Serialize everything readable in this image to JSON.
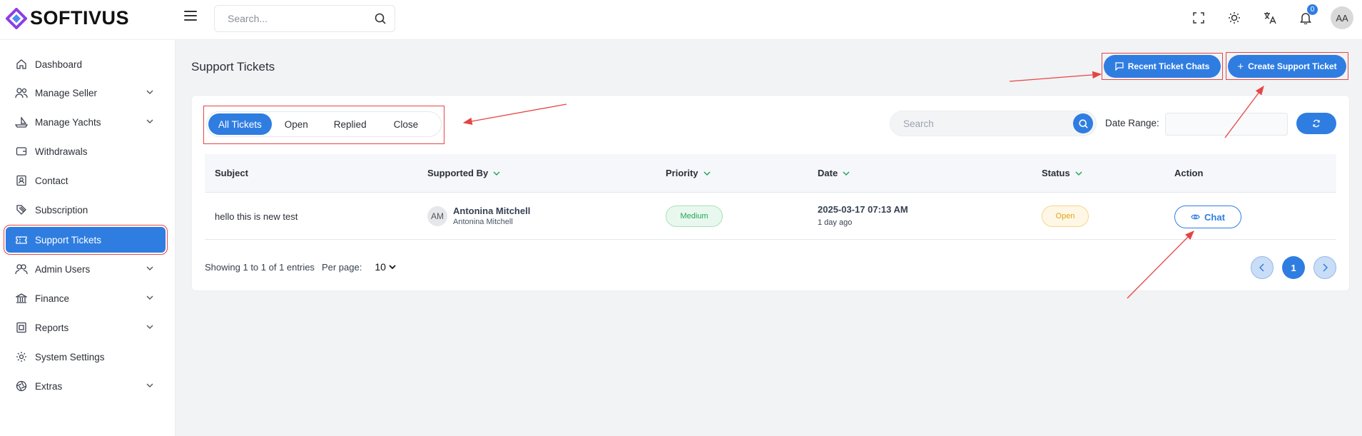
{
  "app": {
    "name": "SOFTIVUS",
    "brand_color": "#2f7de1",
    "accent_color": "#8b3fe6"
  },
  "topbar": {
    "search_placeholder": "Search...",
    "notification_count": "0",
    "user_initials": "AA",
    "icons": [
      "fullscreen-icon",
      "sun-icon",
      "translate-icon",
      "bell-icon"
    ]
  },
  "sidebar": {
    "items": [
      {
        "label": "Dashboard",
        "icon": "home-icon",
        "expandable": false
      },
      {
        "label": "Manage Seller",
        "icon": "users-icon",
        "expandable": true
      },
      {
        "label": "Manage Yachts",
        "icon": "boat-icon",
        "expandable": true
      },
      {
        "label": "Withdrawals",
        "icon": "wallet-icon",
        "expandable": false
      },
      {
        "label": "Contact",
        "icon": "contact-icon",
        "expandable": false
      },
      {
        "label": "Subscription",
        "icon": "tag-icon",
        "expandable": false
      },
      {
        "label": "Support Tickets",
        "icon": "ticket-icon",
        "expandable": false,
        "active": true
      },
      {
        "label": "Admin Users",
        "icon": "admin-users-icon",
        "expandable": true
      },
      {
        "label": "Finance",
        "icon": "bank-icon",
        "expandable": true
      },
      {
        "label": "Reports",
        "icon": "report-icon",
        "expandable": true
      },
      {
        "label": "System Settings",
        "icon": "gear-icon",
        "expandable": false
      },
      {
        "label": "Extras",
        "icon": "aperture-icon",
        "expandable": true
      }
    ]
  },
  "page": {
    "title": "Support Tickets",
    "recent_chats_label": "Recent Ticket Chats",
    "create_ticket_label": "Create Support Ticket"
  },
  "filters": {
    "tabs": [
      "All Tickets",
      "Open",
      "Replied",
      "Close"
    ],
    "active_tab": "All Tickets",
    "search_placeholder": "Search",
    "date_range_label": "Date Range:"
  },
  "table": {
    "columns": [
      "Subject",
      "Supported By",
      "Priority",
      "Date",
      "Status",
      "Action"
    ],
    "rows": [
      {
        "subject": "hello this is new test",
        "avatar": "AM",
        "supporter_name": "Antonina Mitchell",
        "supporter_sub": "Antonina Mitchell",
        "priority": "Medium",
        "date": "2025-03-17 07:13 AM",
        "relative": "1 day ago",
        "status": "Open",
        "action": "Chat"
      }
    ]
  },
  "footer": {
    "showing": "Showing 1 to 1 of 1 entries",
    "per_page_label": "Per page:",
    "per_page_value": "10",
    "current_page": "1"
  },
  "colors": {
    "priority_medium_bg": "#e9f8ee",
    "priority_medium_text": "#22a55a",
    "status_open_bg": "#fff7e6",
    "status_open_text": "#e2a316",
    "annotation_red": "#e64545"
  }
}
